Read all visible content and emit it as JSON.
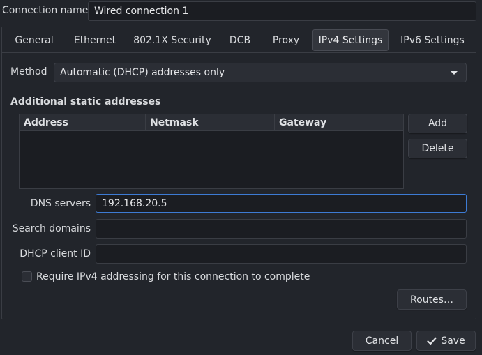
{
  "connection_name": {
    "label": "Connection name",
    "value": "Wired connection 1"
  },
  "tabs": [
    {
      "label": "General",
      "active": false
    },
    {
      "label": "Ethernet",
      "active": false
    },
    {
      "label": "802.1X Security",
      "active": false
    },
    {
      "label": "DCB",
      "active": false
    },
    {
      "label": "Proxy",
      "active": false
    },
    {
      "label": "IPv4 Settings",
      "active": true
    },
    {
      "label": "IPv6 Settings",
      "active": false
    }
  ],
  "method": {
    "label": "Method",
    "selected": "Automatic (DHCP) addresses only"
  },
  "static_addresses": {
    "heading": "Additional static addresses",
    "columns": [
      "Address",
      "Netmask",
      "Gateway"
    ],
    "rows": [],
    "add_label": "Add",
    "delete_label": "Delete"
  },
  "dns_servers": {
    "label": "DNS servers",
    "value": "192.168.20.5"
  },
  "search_domains": {
    "label": "Search domains",
    "value": ""
  },
  "dhcp_client_id": {
    "label": "DHCP client ID",
    "value": ""
  },
  "require_ipv4": {
    "label": "Require IPv4 addressing for this connection to complete",
    "checked": false
  },
  "routes_label": "Routes…",
  "cancel_label": "Cancel",
  "save_label": "Save",
  "icons": {
    "save": "checkmark-icon",
    "method_dropdown": "chevron-down-icon"
  },
  "colors": {
    "background": "#22252b",
    "focus": "#3d7bd4"
  }
}
